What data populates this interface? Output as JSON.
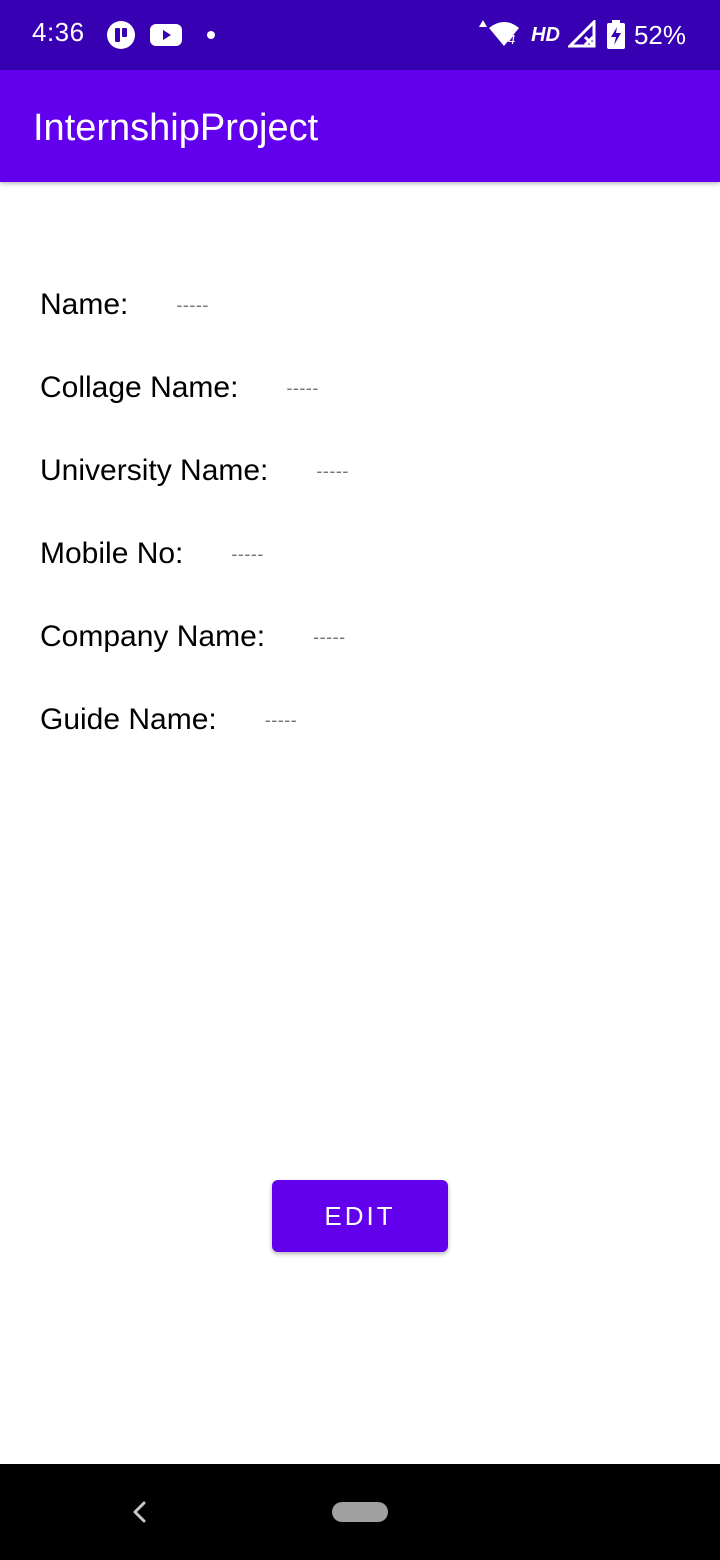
{
  "status_bar": {
    "time": "4:36",
    "network_label": "HD",
    "battery": "52%",
    "icons": [
      "app-notification-icon",
      "youtube-icon",
      "dot-icon",
      "wifi-icon",
      "signal-icon",
      "battery-charging-icon"
    ]
  },
  "app_bar": {
    "title": "InternshipProject"
  },
  "profile": {
    "fields": [
      {
        "label": "Name:",
        "value": "-----"
      },
      {
        "label": "Collage Name:",
        "value": "-----"
      },
      {
        "label": "University Name:",
        "value": "-----"
      },
      {
        "label": "Mobile No:",
        "value": "-----"
      },
      {
        "label": "Company Name:",
        "value": "-----"
      },
      {
        "label": "Guide Name:",
        "value": "-----"
      }
    ]
  },
  "actions": {
    "edit_label": "EDIT"
  },
  "colors": {
    "status_bar": "#3700b3",
    "primary": "#6200ee",
    "placeholder_text": "#757575"
  }
}
